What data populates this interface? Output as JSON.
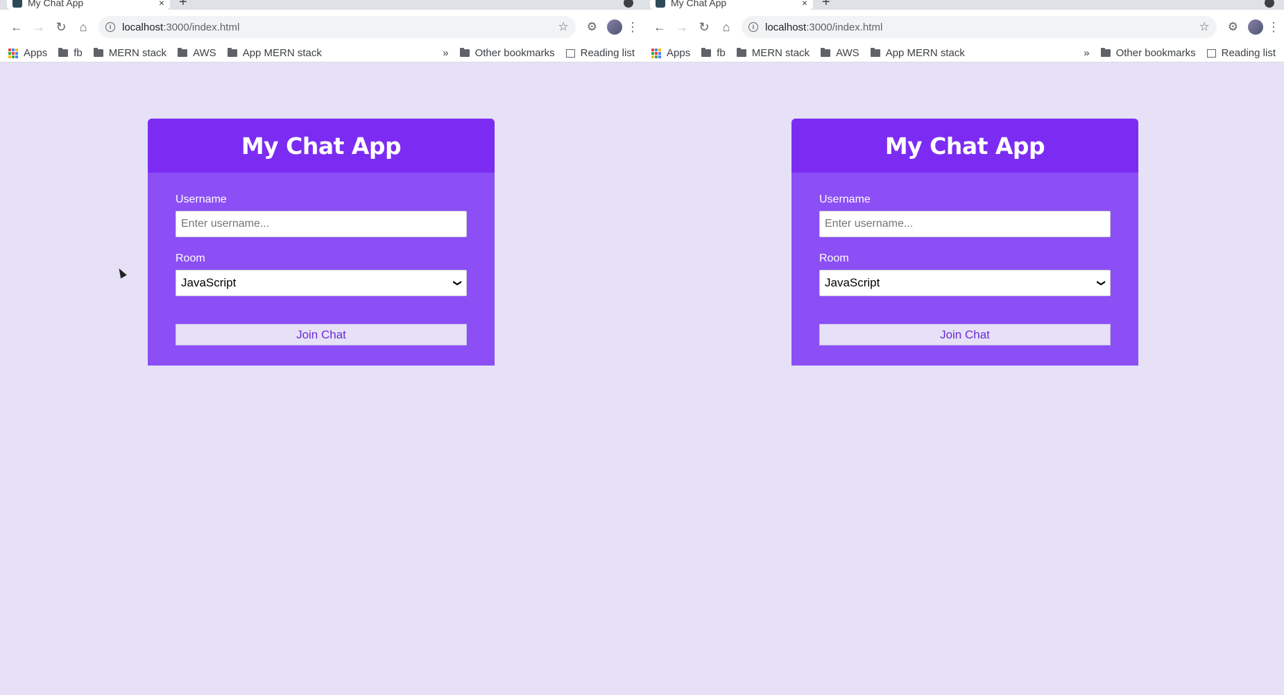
{
  "tab": {
    "title": "My Chat App",
    "close": "×",
    "new_tab": "+"
  },
  "omnibox": {
    "host": "localhost",
    "rest": ":3000/index.html"
  },
  "bookmarks": {
    "apps": "Apps",
    "items": [
      "fb",
      "MERN stack",
      "AWS",
      "App MERN stack"
    ],
    "overflow": "»",
    "other": "Other bookmarks",
    "reading": "Reading list"
  },
  "card": {
    "title": "My Chat App",
    "username_label": "Username",
    "username_placeholder": "Enter username...",
    "room_label": "Room",
    "room_selected": "JavaScript",
    "join_label": "Join Chat"
  },
  "colors": {
    "page_bg": "#e6e1f7",
    "card_header": "#7c2cf2",
    "card_body": "#8b4ff5",
    "button_text": "#6b2bd6"
  }
}
